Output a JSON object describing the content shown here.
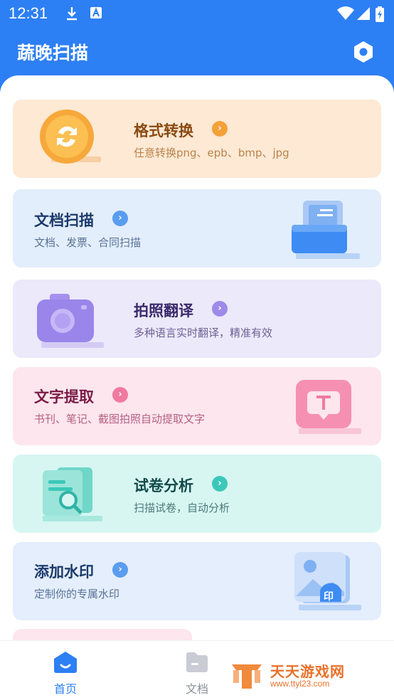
{
  "status_bar": {
    "time": "12:31",
    "icons": [
      "download-icon",
      "accessibility-icon",
      "wifi-icon",
      "signal-icon",
      "battery-icon"
    ]
  },
  "app_bar": {
    "title": "蔬晚扫描",
    "settings_icon": "gear-hexagon-icon"
  },
  "cards": [
    {
      "title": "格式转换",
      "subtitle": "任意转换png、epb、bmp、jpg",
      "icon": "refresh-coin-icon",
      "bg": "#fde9d4",
      "accent": "#f4a13a",
      "title_color": "#8a4a12",
      "sub_color": "#b9834d"
    },
    {
      "title": "文档扫描",
      "subtitle": "文档、发票、合同扫描",
      "icon": "document-scan-icon",
      "bg": "#e3eefc",
      "accent": "#5a9cf0",
      "title_color": "#1c3a6b",
      "sub_color": "#5a7196"
    },
    {
      "title": "拍照翻译",
      "subtitle": "多种语言实时翻译，精准有效",
      "icon": "camera-icon",
      "bg": "#ece9fb",
      "accent": "#9e8ae8",
      "title_color": "#3a2a6b",
      "sub_color": "#6d6193"
    },
    {
      "title": "文字提取",
      "subtitle": "书刊、笔记、截图拍照自动提取文字",
      "icon": "text-extract-icon",
      "bg": "#fde6ee",
      "accent": "#f07aa0",
      "title_color": "#7a1c45",
      "sub_color": "#b46182"
    },
    {
      "title": "试卷分析",
      "subtitle": "扫描试卷，自动分析",
      "icon": "paper-analysis-icon",
      "bg": "#d7f6f2",
      "accent": "#3cc8b9",
      "title_color": "#124a4a",
      "sub_color": "#4b7b79"
    },
    {
      "title": "添加水印",
      "subtitle": "定制你的专属水印",
      "icon": "watermark-image-icon",
      "bg": "#e4eefc",
      "accent": "#5a9cf0",
      "title_color": "#1c3a6b",
      "sub_color": "#5a7196",
      "badge": "印"
    }
  ],
  "bottom_nav": {
    "items": [
      {
        "label": "首页",
        "icon": "home-icon",
        "active": true
      },
      {
        "label": "文档",
        "icon": "folder-icon",
        "active": false
      }
    ]
  },
  "watermark": {
    "name": "天天游戏网",
    "url": "www.ttyl23.com"
  },
  "colors": {
    "primary": "#2d7ff4",
    "nav_active": "#2d7ff4",
    "nav_inactive": "#8a8f99"
  }
}
